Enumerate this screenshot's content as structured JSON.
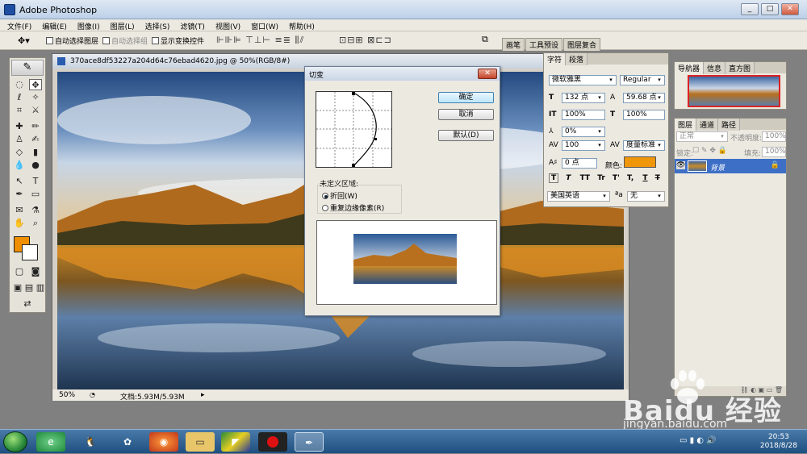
{
  "app": {
    "title": "Adobe Photoshop",
    "win_min": "_",
    "win_max": "□",
    "win_close": "✕"
  },
  "menu": [
    "文件(F)",
    "编辑(E)",
    "图像(I)",
    "图层(L)",
    "选择(S)",
    "滤镜(T)",
    "视图(V)",
    "窗口(W)",
    "帮助(H)"
  ],
  "options": {
    "auto_select_layer": "自动选择图层",
    "auto_select_group": "自动选择组",
    "show_transform": "显示变换控件",
    "align_icons": "⊩⊪⊫ ⊤⊥⊢ ≡≣ ⫼⫽",
    "distribute_icons": "⊡⊟⊞ ⊠⊏⊐"
  },
  "wells": [
    "画笔",
    "工具预设",
    "图层复合"
  ],
  "document": {
    "title": "370ace8df53227a204d64c76ebad4620.jpg @ 50%(RGB/8#)",
    "zoom": "50%",
    "doc_size": "文档:5.93M/5.93M"
  },
  "dialog": {
    "title": "切变",
    "ok": "确定",
    "cancel": "取消",
    "default": "默认(D)",
    "undefined_area": "未定义区域:",
    "wrap": "折回(W)",
    "repeat_edge": "重复边缘像素(R)",
    "selected_option": "wrap"
  },
  "char_panel": {
    "tabs": [
      "字符",
      "段落"
    ],
    "font": "微软雅黑",
    "style": "Regular",
    "size": "132 点",
    "leading": "59.68 点",
    "vscale": "100%",
    "hscale": "100%",
    "tracking": "0%",
    "kerning": "100",
    "kerning_mode": "度量标准",
    "baseline": "0 点",
    "color_label": "颜色:",
    "color": "#f0960a",
    "language": "美国英语",
    "aa_label": "a",
    "aa": "无",
    "type_buttons": [
      "T",
      "T",
      "TT",
      "Tr",
      "T'",
      "T,",
      "T",
      "T"
    ]
  },
  "navigator": {
    "tabs": [
      "导航器",
      "信息",
      "直方图"
    ]
  },
  "layers": {
    "tabs": [
      "图层",
      "通道",
      "路径"
    ],
    "blend": "正常",
    "opacity_label": "不透明度:",
    "opacity": "100%",
    "lock_label": "锁定:",
    "fill_label": "填充:",
    "fill": "100%",
    "layer_name": "背景"
  },
  "taskbar": {
    "time": "20:53",
    "date": "2018/8/28",
    "icons": [
      "ie",
      "qq",
      "media",
      "firefox",
      "folder",
      "flag",
      "record",
      "photoshop"
    ]
  },
  "watermark": {
    "brand": "Baidu 经验",
    "url": "jingyan.baidu.com"
  }
}
